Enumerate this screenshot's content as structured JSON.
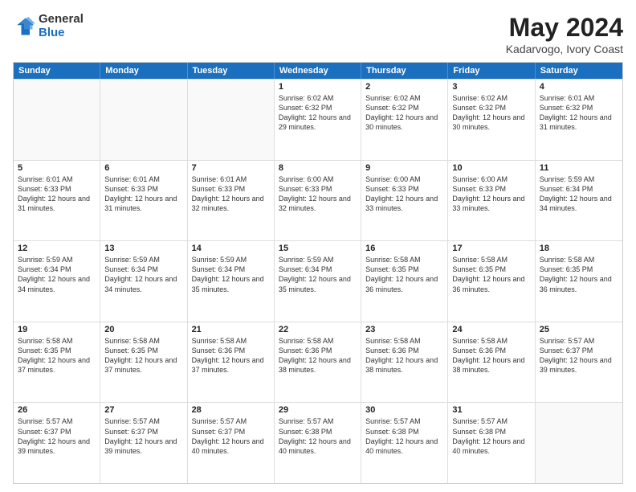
{
  "logo": {
    "general": "General",
    "blue": "Blue"
  },
  "title": {
    "month_year": "May 2024",
    "location": "Kadarvogo, Ivory Coast"
  },
  "weekdays": [
    "Sunday",
    "Monday",
    "Tuesday",
    "Wednesday",
    "Thursday",
    "Friday",
    "Saturday"
  ],
  "rows": [
    [
      {
        "day": "",
        "text": ""
      },
      {
        "day": "",
        "text": ""
      },
      {
        "day": "",
        "text": ""
      },
      {
        "day": "1",
        "text": "Sunrise: 6:02 AM\nSunset: 6:32 PM\nDaylight: 12 hours and 29 minutes."
      },
      {
        "day": "2",
        "text": "Sunrise: 6:02 AM\nSunset: 6:32 PM\nDaylight: 12 hours and 30 minutes."
      },
      {
        "day": "3",
        "text": "Sunrise: 6:02 AM\nSunset: 6:32 PM\nDaylight: 12 hours and 30 minutes."
      },
      {
        "day": "4",
        "text": "Sunrise: 6:01 AM\nSunset: 6:32 PM\nDaylight: 12 hours and 31 minutes."
      }
    ],
    [
      {
        "day": "5",
        "text": "Sunrise: 6:01 AM\nSunset: 6:33 PM\nDaylight: 12 hours and 31 minutes."
      },
      {
        "day": "6",
        "text": "Sunrise: 6:01 AM\nSunset: 6:33 PM\nDaylight: 12 hours and 31 minutes."
      },
      {
        "day": "7",
        "text": "Sunrise: 6:01 AM\nSunset: 6:33 PM\nDaylight: 12 hours and 32 minutes."
      },
      {
        "day": "8",
        "text": "Sunrise: 6:00 AM\nSunset: 6:33 PM\nDaylight: 12 hours and 32 minutes."
      },
      {
        "day": "9",
        "text": "Sunrise: 6:00 AM\nSunset: 6:33 PM\nDaylight: 12 hours and 33 minutes."
      },
      {
        "day": "10",
        "text": "Sunrise: 6:00 AM\nSunset: 6:33 PM\nDaylight: 12 hours and 33 minutes."
      },
      {
        "day": "11",
        "text": "Sunrise: 5:59 AM\nSunset: 6:34 PM\nDaylight: 12 hours and 34 minutes."
      }
    ],
    [
      {
        "day": "12",
        "text": "Sunrise: 5:59 AM\nSunset: 6:34 PM\nDaylight: 12 hours and 34 minutes."
      },
      {
        "day": "13",
        "text": "Sunrise: 5:59 AM\nSunset: 6:34 PM\nDaylight: 12 hours and 34 minutes."
      },
      {
        "day": "14",
        "text": "Sunrise: 5:59 AM\nSunset: 6:34 PM\nDaylight: 12 hours and 35 minutes."
      },
      {
        "day": "15",
        "text": "Sunrise: 5:59 AM\nSunset: 6:34 PM\nDaylight: 12 hours and 35 minutes."
      },
      {
        "day": "16",
        "text": "Sunrise: 5:58 AM\nSunset: 6:35 PM\nDaylight: 12 hours and 36 minutes."
      },
      {
        "day": "17",
        "text": "Sunrise: 5:58 AM\nSunset: 6:35 PM\nDaylight: 12 hours and 36 minutes."
      },
      {
        "day": "18",
        "text": "Sunrise: 5:58 AM\nSunset: 6:35 PM\nDaylight: 12 hours and 36 minutes."
      }
    ],
    [
      {
        "day": "19",
        "text": "Sunrise: 5:58 AM\nSunset: 6:35 PM\nDaylight: 12 hours and 37 minutes."
      },
      {
        "day": "20",
        "text": "Sunrise: 5:58 AM\nSunset: 6:35 PM\nDaylight: 12 hours and 37 minutes."
      },
      {
        "day": "21",
        "text": "Sunrise: 5:58 AM\nSunset: 6:36 PM\nDaylight: 12 hours and 37 minutes."
      },
      {
        "day": "22",
        "text": "Sunrise: 5:58 AM\nSunset: 6:36 PM\nDaylight: 12 hours and 38 minutes."
      },
      {
        "day": "23",
        "text": "Sunrise: 5:58 AM\nSunset: 6:36 PM\nDaylight: 12 hours and 38 minutes."
      },
      {
        "day": "24",
        "text": "Sunrise: 5:58 AM\nSunset: 6:36 PM\nDaylight: 12 hours and 38 minutes."
      },
      {
        "day": "25",
        "text": "Sunrise: 5:57 AM\nSunset: 6:37 PM\nDaylight: 12 hours and 39 minutes."
      }
    ],
    [
      {
        "day": "26",
        "text": "Sunrise: 5:57 AM\nSunset: 6:37 PM\nDaylight: 12 hours and 39 minutes."
      },
      {
        "day": "27",
        "text": "Sunrise: 5:57 AM\nSunset: 6:37 PM\nDaylight: 12 hours and 39 minutes."
      },
      {
        "day": "28",
        "text": "Sunrise: 5:57 AM\nSunset: 6:37 PM\nDaylight: 12 hours and 40 minutes."
      },
      {
        "day": "29",
        "text": "Sunrise: 5:57 AM\nSunset: 6:38 PM\nDaylight: 12 hours and 40 minutes."
      },
      {
        "day": "30",
        "text": "Sunrise: 5:57 AM\nSunset: 6:38 PM\nDaylight: 12 hours and 40 minutes."
      },
      {
        "day": "31",
        "text": "Sunrise: 5:57 AM\nSunset: 6:38 PM\nDaylight: 12 hours and 40 minutes."
      },
      {
        "day": "",
        "text": ""
      }
    ]
  ]
}
